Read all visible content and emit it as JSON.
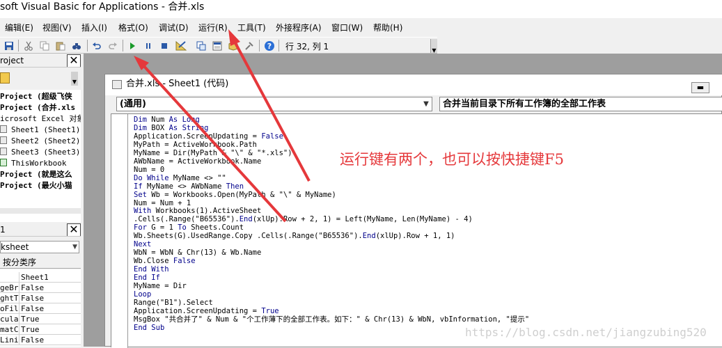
{
  "window": {
    "title": "soft Visual Basic for Applications - 合并.xls"
  },
  "menu": [
    {
      "label": "编辑(E)"
    },
    {
      "label": "视图(V)"
    },
    {
      "label": "插入(I)"
    },
    {
      "label": "格式(O)"
    },
    {
      "label": "调试(D)"
    },
    {
      "label": "运行(R)"
    },
    {
      "label": "工具(T)"
    },
    {
      "label": "外接程序(A)"
    },
    {
      "label": "窗口(W)"
    },
    {
      "label": "帮助(H)"
    }
  ],
  "toolbar": {
    "status_label": "行 32, 列 1"
  },
  "project_pane": {
    "title": "roject",
    "items": [
      {
        "label": "Project (超级飞侠",
        "bold": true
      },
      {
        "label": "Project (合并.xls",
        "bold": true
      },
      {
        "label": "icrosoft Excel 对象",
        "bold": false
      },
      {
        "label": "Sheet1 (Sheet1)",
        "bold": false
      },
      {
        "label": "Sheet2 (Sheet2)",
        "bold": false
      },
      {
        "label": "Sheet3 (Sheet3)",
        "bold": false
      },
      {
        "label": "ThisWorkbook",
        "bold": false
      },
      {
        "label": "Project (就是这么",
        "bold": true
      },
      {
        "label": "Project (最火小猫",
        "bold": true
      }
    ]
  },
  "properties_pane": {
    "title": "1",
    "object_combo": "ksheet",
    "tab_label": "按分类序",
    "rows": [
      {
        "name": "",
        "value": "Sheet1"
      },
      {
        "name": "geBre",
        "value": "False"
      },
      {
        "name": "ghtTo",
        "value": "False"
      },
      {
        "name": "oFilt",
        "value": "False"
      },
      {
        "name": "culat",
        "value": "True"
      },
      {
        "name": "matCo",
        "value": "True"
      },
      {
        "name": "Linin",
        "value": "False"
      }
    ]
  },
  "code_window": {
    "title": "合并.xls - Sheet1 (代码)",
    "object_combo": "(通用)",
    "proc_combo": "合并当前目录下所有工作簿的全部工作表",
    "lines": [
      "Dim Num As Long",
      "Dim BOX As String",
      "Application.ScreenUpdating = False",
      "MyPath = ActiveWorkbook.Path",
      "MyName = Dir(MyPath & \"\\\" & \"*.xls\")",
      "AWbName = ActiveWorkbook.Name",
      "Num = 0",
      "Do While MyName <> \"\"",
      "If MyName <> AWbName Then",
      "Set Wb = Workbooks.Open(MyPath & \"\\\" & MyName)",
      "Num = Num + 1",
      "With Workbooks(1).ActiveSheet",
      ".Cells(.Range(\"B65536\").End(xlUp).Row + 2, 1) = Left(MyName, Len(MyName) - 4)",
      "For G = 1 To Sheets.Count",
      "Wb.Sheets(G).UsedRange.Copy .Cells(.Range(\"B65536\").End(xlUp).Row + 1, 1)",
      "Next",
      "WbN = WbN & Chr(13) & Wb.Name",
      "Wb.Close False",
      "End With",
      "End If",
      "MyName = Dir",
      "Loop",
      "Range(\"B1\").Select",
      "Application.ScreenUpdating = True",
      "MsgBox \"共合并了\" & Num & \"个工作薄下的全部工作表。如下：\" & Chr(13) & WbN, vbInformation, \"提示\"",
      "End Sub"
    ]
  },
  "annotation": {
    "text": "运行键有两个，也可以按快捷键F5",
    "color": "#e5383b"
  },
  "watermark": {
    "text": "https://blog.csdn.net/jiangzubing520"
  }
}
